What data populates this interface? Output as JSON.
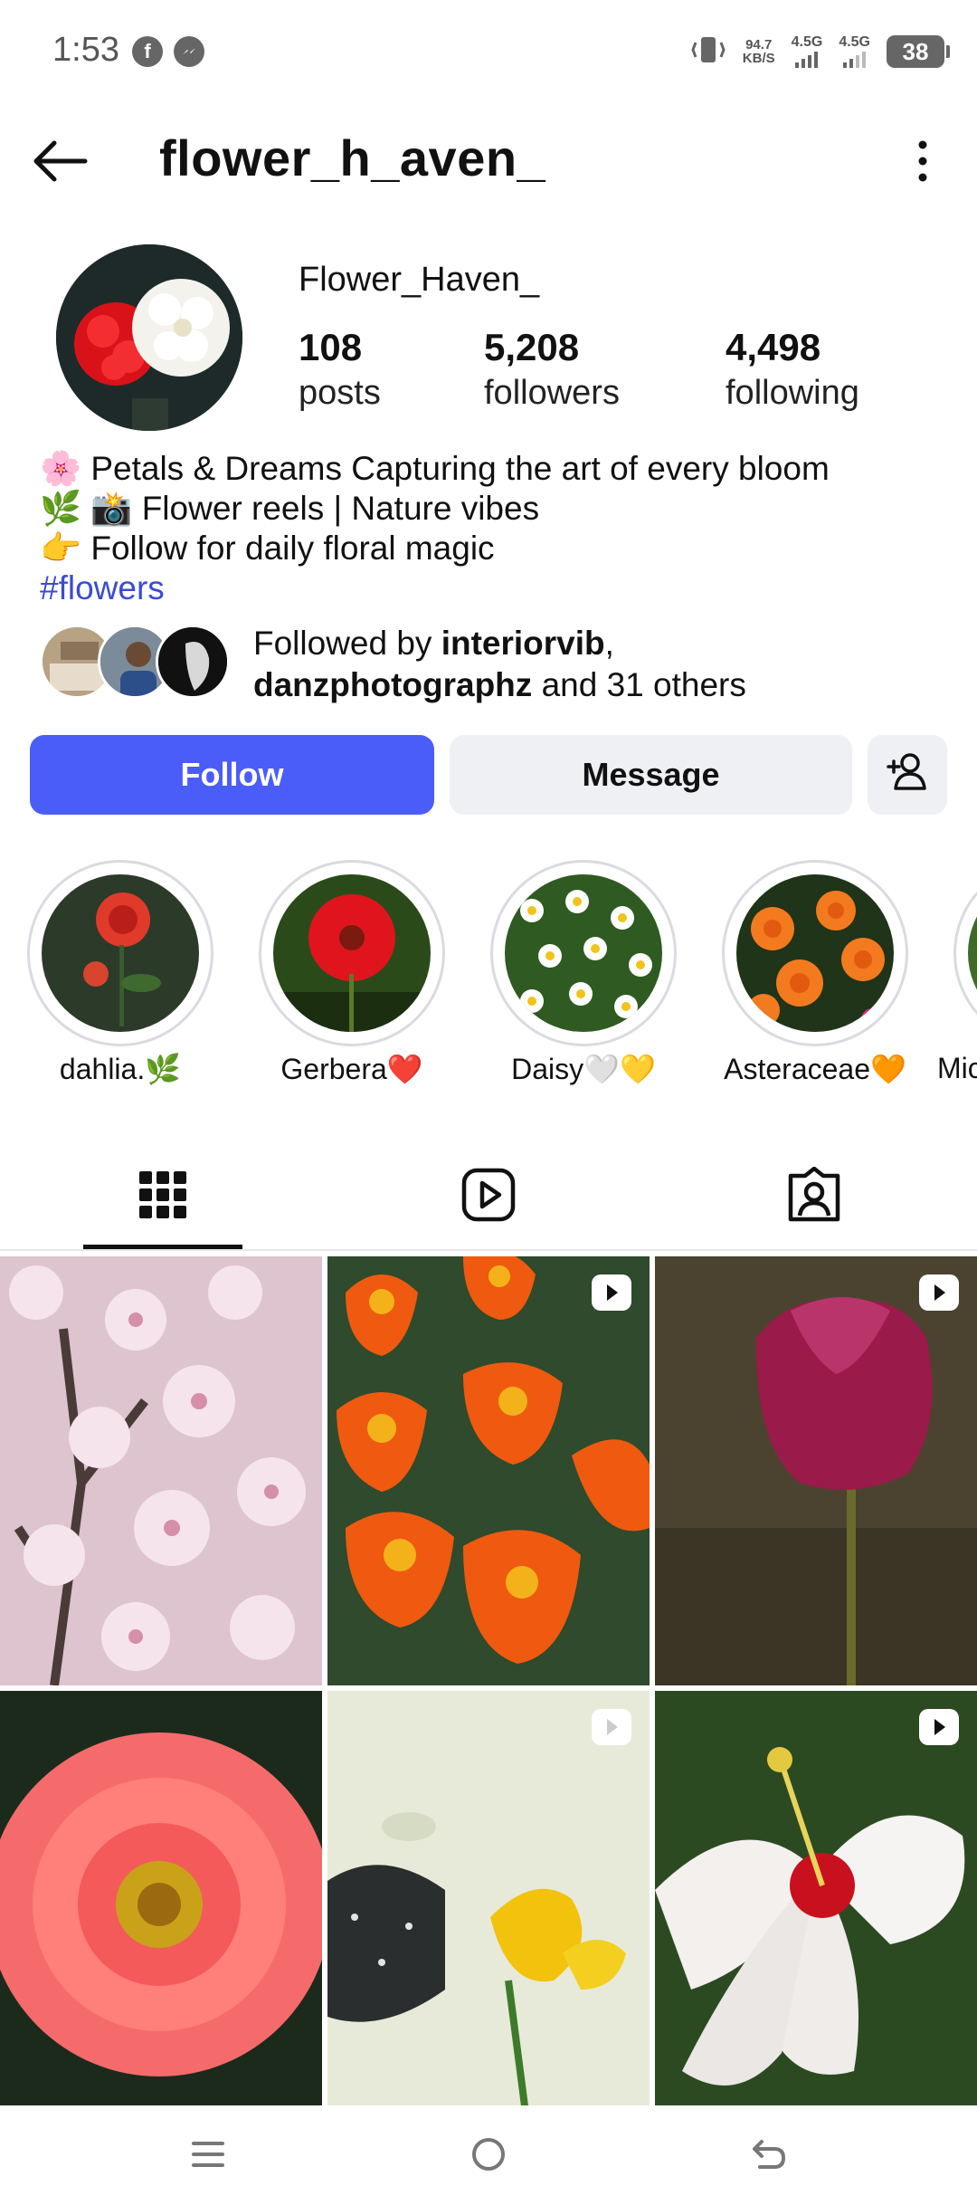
{
  "status_bar": {
    "time": "1:53",
    "app_icons": [
      "facebook-icon",
      "messenger-icon"
    ],
    "net_speed_value": "94.7",
    "net_speed_unit": "KB/S",
    "network_1": "4.5G",
    "network_2": "4.5G",
    "battery": "38"
  },
  "header": {
    "handle": "flower_h_aven_"
  },
  "profile": {
    "name": "Flower_Haven_",
    "stats": [
      {
        "value": "108",
        "label": "posts"
      },
      {
        "value": "5,208",
        "label": "followers"
      },
      {
        "value": "4,498",
        "label": "following"
      }
    ],
    "bio": [
      "🌸 Petals & Dreams Capturing the art of every bloom",
      "🌿 📸 Flower reels | Nature vibes",
      "👉 Follow for daily floral magic"
    ],
    "hashtag": "#flowers",
    "followed_by": {
      "prefix": "Followed by ",
      "user1": "interiorvib",
      "comma": ",",
      "user2": "danzphotographz",
      "suffix": " and 31 others"
    }
  },
  "actions": {
    "follow_label": "Follow",
    "message_label": "Message"
  },
  "highlights": [
    {
      "label": "dahlia.🌿"
    },
    {
      "label": "Gerbera❤️"
    },
    {
      "label": "Daisy🤍💛"
    },
    {
      "label": "Asteraceae🧡"
    },
    {
      "label": "Mic"
    }
  ],
  "tabs": [
    "grid-icon",
    "reels-icon",
    "tagged-icon"
  ],
  "colors": {
    "accent": "#4a5df9",
    "hashtag": "#3a4bd1",
    "button_secondary": "#eff0f3"
  }
}
